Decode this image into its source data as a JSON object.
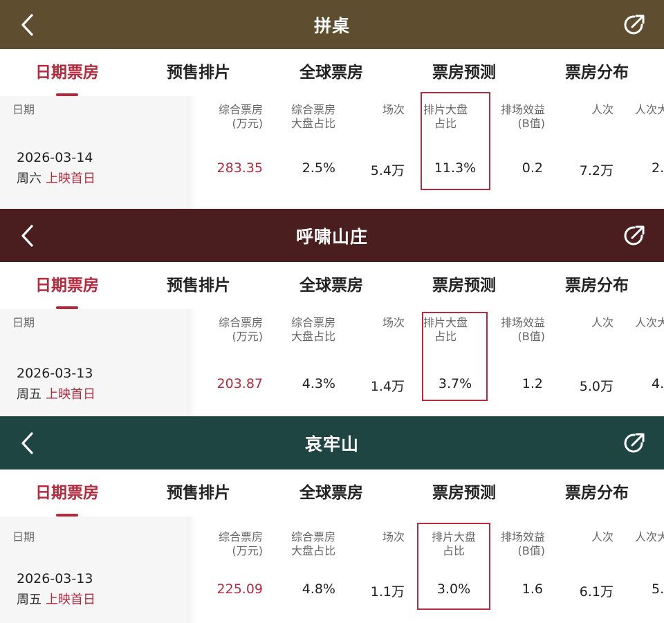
{
  "tabs": [
    "日期票房",
    "预售排片",
    "全球票房",
    "票房预测",
    "票房分布"
  ],
  "table_headers": {
    "date": "日期",
    "box_office_l1": "综合票房",
    "box_office_l2": "(万元)",
    "share_l1": "综合票房",
    "share_l2": "大盘占比",
    "shows": "场次",
    "schedule_l1": "排片大盘",
    "schedule_l2": "占比",
    "benefit_l1": "排场效益",
    "benefit_l2": "(B值)",
    "people": "人次",
    "per_avg": "人次大"
  },
  "panels": [
    {
      "title": "拼桌",
      "header_color": "#5e4e2f",
      "date": "2026-03-14",
      "weekday": "周六",
      "premiere_label": "上映首日",
      "box_office": "283.35",
      "share": "2.5%",
      "shows": "5.4万",
      "schedule_share": "11.3%",
      "benefit": "0.2",
      "people": "7.2万",
      "per_avg": "2."
    },
    {
      "title": "呼啸山庄",
      "header_color": "#4a1d1f",
      "date": "2026-03-13",
      "weekday": "周五",
      "premiere_label": "上映首日",
      "box_office": "203.87",
      "share": "4.3%",
      "shows": "1.4万",
      "schedule_share": "3.7%",
      "benefit": "1.2",
      "people": "5.0万",
      "per_avg": "4."
    },
    {
      "title": "哀牢山",
      "header_color": "#1e4541",
      "date": "2026-03-13",
      "weekday": "周五",
      "premiere_label": "上映首日",
      "box_office": "225.09",
      "share": "4.8%",
      "shows": "1.1万",
      "schedule_share": "3.0%",
      "benefit": "1.6",
      "people": "6.1万",
      "per_avg": "5."
    }
  ],
  "accent_color": "#b8293c"
}
